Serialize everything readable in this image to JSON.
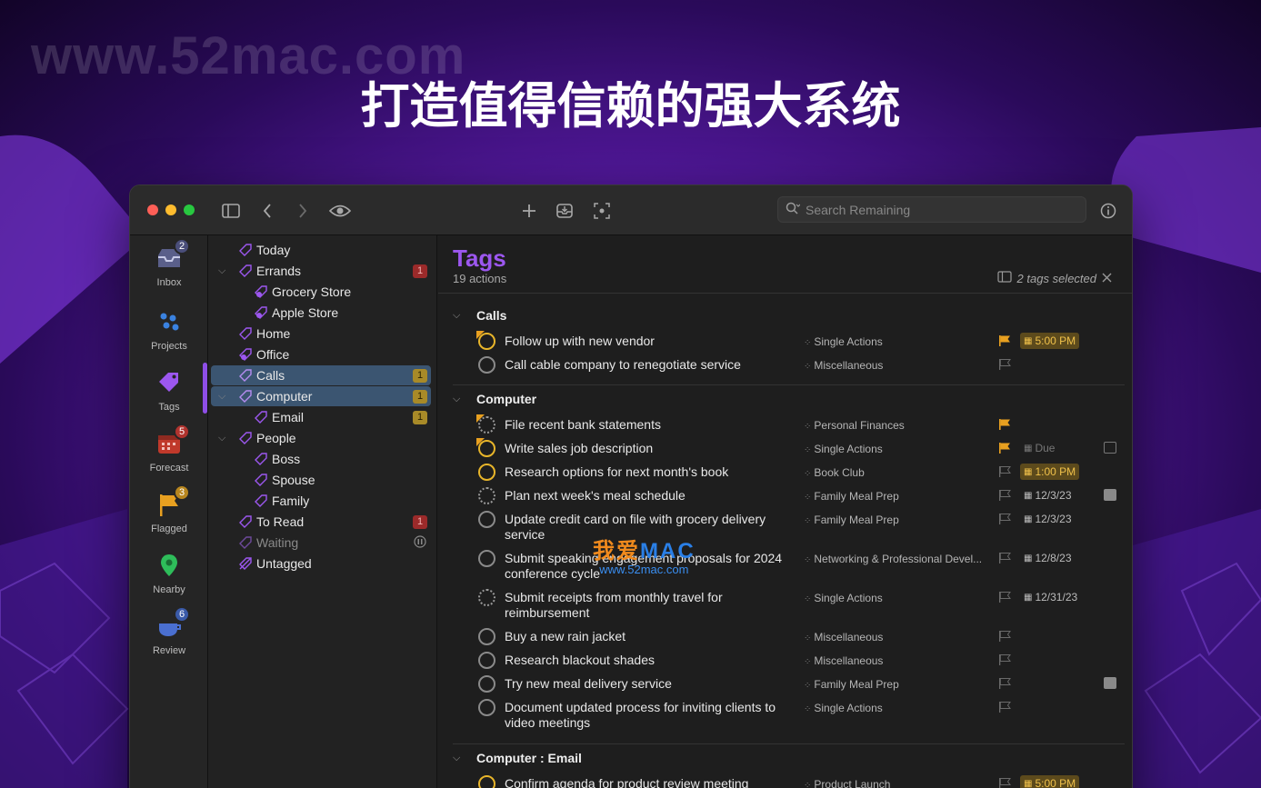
{
  "watermark": "www.52mac.com",
  "headline": "打造值得信赖的强大系统",
  "toolbar": {
    "search_placeholder": "Search Remaining"
  },
  "perspectives": [
    {
      "label": "Inbox",
      "badge": "2",
      "badge_color": "#4a4e7a",
      "icon": "inbox-icon"
    },
    {
      "label": "Projects",
      "badge": "",
      "icon": "projects-icon"
    },
    {
      "label": "Tags",
      "badge": "",
      "icon": "tag-icon"
    },
    {
      "label": "Forecast",
      "badge": "5",
      "badge_color": "#b0332e",
      "icon": "calendar-icon"
    },
    {
      "label": "Flagged",
      "badge": "3",
      "badge_color": "#b8861e",
      "icon": "flag-icon"
    },
    {
      "label": "Nearby",
      "badge": "",
      "icon": "location-pin-icon"
    },
    {
      "label": "Review",
      "badge": "6",
      "badge_color": "#3a5aa8",
      "icon": "review-icon"
    }
  ],
  "sidebar": {
    "items": [
      {
        "label": "Today",
        "count": ""
      },
      {
        "label": "Errands",
        "count": "1"
      },
      {
        "label": "Grocery Store",
        "count": ""
      },
      {
        "label": "Apple Store",
        "count": ""
      },
      {
        "label": "Home",
        "count": ""
      },
      {
        "label": "Office",
        "count": ""
      },
      {
        "label": "Calls",
        "count": "1"
      },
      {
        "label": "Computer",
        "count": "1"
      },
      {
        "label": "Email",
        "count": "1"
      },
      {
        "label": "People",
        "count": ""
      },
      {
        "label": "Boss",
        "count": ""
      },
      {
        "label": "Spouse",
        "count": ""
      },
      {
        "label": "Family",
        "count": ""
      },
      {
        "label": "To Read",
        "count": "1"
      },
      {
        "label": "Waiting",
        "count": ""
      },
      {
        "label": "Untagged",
        "count": ""
      }
    ]
  },
  "main": {
    "title": "Tags",
    "subtitle": "19 actions",
    "selection_info": "2 tags selected",
    "groups": [
      {
        "label": "Calls"
      },
      {
        "label": "Computer"
      },
      {
        "label": "Computer : Email"
      }
    ],
    "tasks": [
      {
        "title": "Follow up with new vendor",
        "project": "Single Actions",
        "date": "5:00 PM"
      },
      {
        "title": "Call cable company to renegotiate service",
        "project": "Miscellaneous",
        "date": ""
      },
      {
        "title": "File recent bank statements",
        "project": "Personal Finances",
        "date": ""
      },
      {
        "title": "Write sales job description",
        "project": "Single Actions",
        "date": "Due"
      },
      {
        "title": "Research options for next month's book",
        "project": "Book Club",
        "date": "1:00 PM"
      },
      {
        "title": "Plan next week's meal schedule",
        "project": "Family Meal Prep",
        "date": "12/3/23"
      },
      {
        "title": "Update credit card on file with grocery delivery service",
        "project": "Family Meal Prep",
        "date": "12/3/23"
      },
      {
        "title": "Submit speaking engagement proposals for 2024 conference cycle",
        "project": "Networking & Professional Devel...",
        "date": "12/8/23"
      },
      {
        "title": "Submit receipts from monthly travel for reimbursement",
        "project": "Single Actions",
        "date": "12/31/23"
      },
      {
        "title": "Buy a new rain jacket",
        "project": "Miscellaneous",
        "date": ""
      },
      {
        "title": "Research blackout shades",
        "project": "Miscellaneous",
        "date": ""
      },
      {
        "title": "Try new meal delivery service",
        "project": "Family Meal Prep",
        "date": ""
      },
      {
        "title": "Document updated process for inviting clients to video meetings",
        "project": "Single Actions",
        "date": ""
      },
      {
        "title": "Confirm agenda for product review meeting",
        "project": "Product Launch",
        "date": "5:00 PM"
      }
    ]
  },
  "overlay_watermark": {
    "brand_a": "我爱",
    "brand_b": "MAC",
    "url": "www.52mac.com"
  },
  "colors": {
    "accent_purple": "#9c57ef",
    "flag_orange": "#e8a020",
    "due_yellow": "#e8b52a",
    "selection_blue": "#3b5571"
  }
}
